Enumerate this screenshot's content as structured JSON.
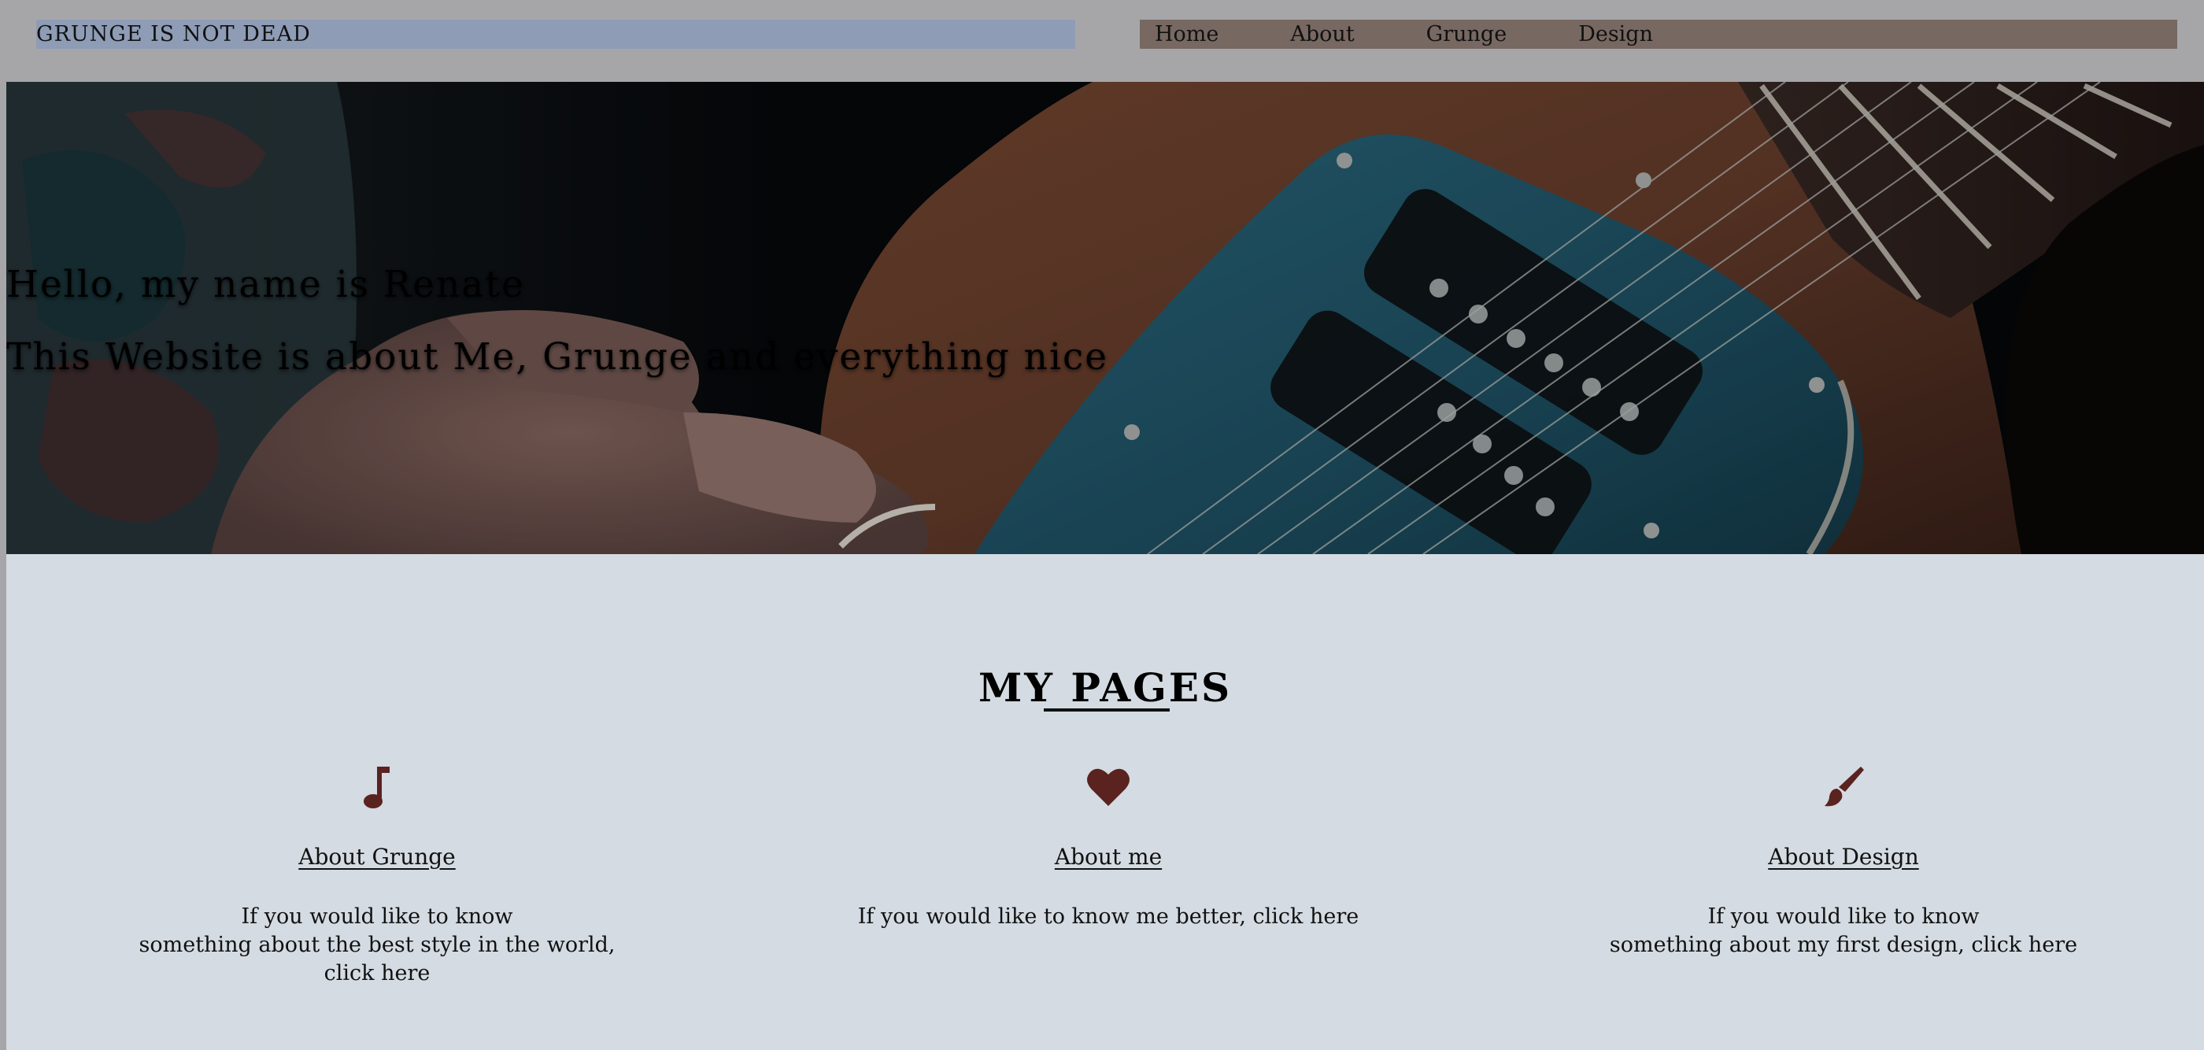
{
  "header": {
    "site_title": "GRUNGE IS NOT DEAD",
    "nav": [
      "Home",
      "About",
      "Grunge",
      "Design"
    ]
  },
  "hero": {
    "line1": "Hello, my name is Renate",
    "line2": "This Website is about Me, Grunge and everything nice"
  },
  "pages": {
    "heading": "MY PAGES",
    "cards": [
      {
        "icon": "music-note-icon",
        "link": "About Grunge",
        "text_lines": [
          "If you would like to know",
          "something about the best style in the world,",
          "click here"
        ]
      },
      {
        "icon": "heart-icon",
        "link": "About me",
        "text_lines": [
          "If you would like to know me better, click here"
        ]
      },
      {
        "icon": "paintbrush-icon",
        "link": "About Design",
        "text_lines": [
          "If you would like to know",
          "something about my first design, click here"
        ]
      }
    ]
  },
  "colors": {
    "page_bg": "#a6a6a9",
    "title_bar": "#8e9cb6",
    "nav_bar": "#776861",
    "section_bg": "#d4dbe2",
    "icon": "#5a2320"
  }
}
